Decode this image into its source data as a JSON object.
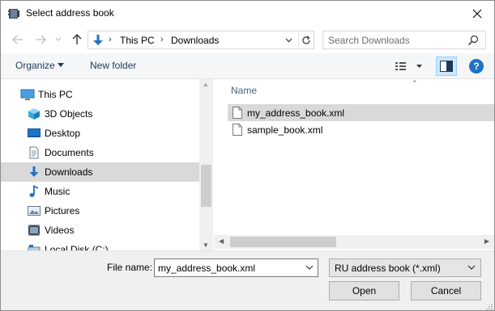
{
  "window": {
    "title": "Select address book",
    "title_icon": "address-book-icon",
    "close_icon": "close-icon"
  },
  "nav": {
    "back_icon": "arrow-left-icon",
    "forward_icon": "arrow-right-icon",
    "recent_icon": "chevron-down-icon",
    "up_icon": "arrow-up-icon",
    "address": {
      "icon": "downloads-icon",
      "crumbs": [
        "This PC",
        "Downloads"
      ],
      "dropdown_icon": "chevron-down-icon",
      "refresh_icon": "refresh-icon"
    },
    "search": {
      "placeholder": "Search Downloads",
      "icon": "search-icon"
    }
  },
  "toolbar": {
    "organize_label": "Organize",
    "new_folder_label": "New folder",
    "view_icon": "view-details-icon",
    "preview_icon": "preview-pane-icon",
    "help_label": "?"
  },
  "nav_pane": {
    "items": [
      {
        "label": "This PC",
        "icon": "pc-icon",
        "selected": false
      },
      {
        "label": "3D Objects",
        "icon": "3d-objects-icon",
        "selected": false
      },
      {
        "label": "Desktop",
        "icon": "desktop-icon",
        "selected": false
      },
      {
        "label": "Documents",
        "icon": "documents-icon",
        "selected": false
      },
      {
        "label": "Downloads",
        "icon": "downloads-icon",
        "selected": true
      },
      {
        "label": "Music",
        "icon": "music-icon",
        "selected": false
      },
      {
        "label": "Pictures",
        "icon": "pictures-icon",
        "selected": false
      },
      {
        "label": "Videos",
        "icon": "videos-icon",
        "selected": false
      },
      {
        "label": "Local Disk (C:)",
        "icon": "disk-icon",
        "selected": false
      }
    ]
  },
  "file_list": {
    "column_name": "Name",
    "files": [
      {
        "name": "my_address_book.xml",
        "icon": "file-icon",
        "selected": true
      },
      {
        "name": "sample_book.xml",
        "icon": "file-icon",
        "selected": false
      }
    ]
  },
  "bottom": {
    "file_name_label": "File name:",
    "file_name_value": "my_address_book.xml",
    "file_type_value": "RU address book (*.xml)",
    "open_label": "Open",
    "cancel_label": "Cancel"
  },
  "colors": {
    "accent": "#1e73c8",
    "selection": "#d9d9d9",
    "toolbar_text": "#1e395b"
  }
}
